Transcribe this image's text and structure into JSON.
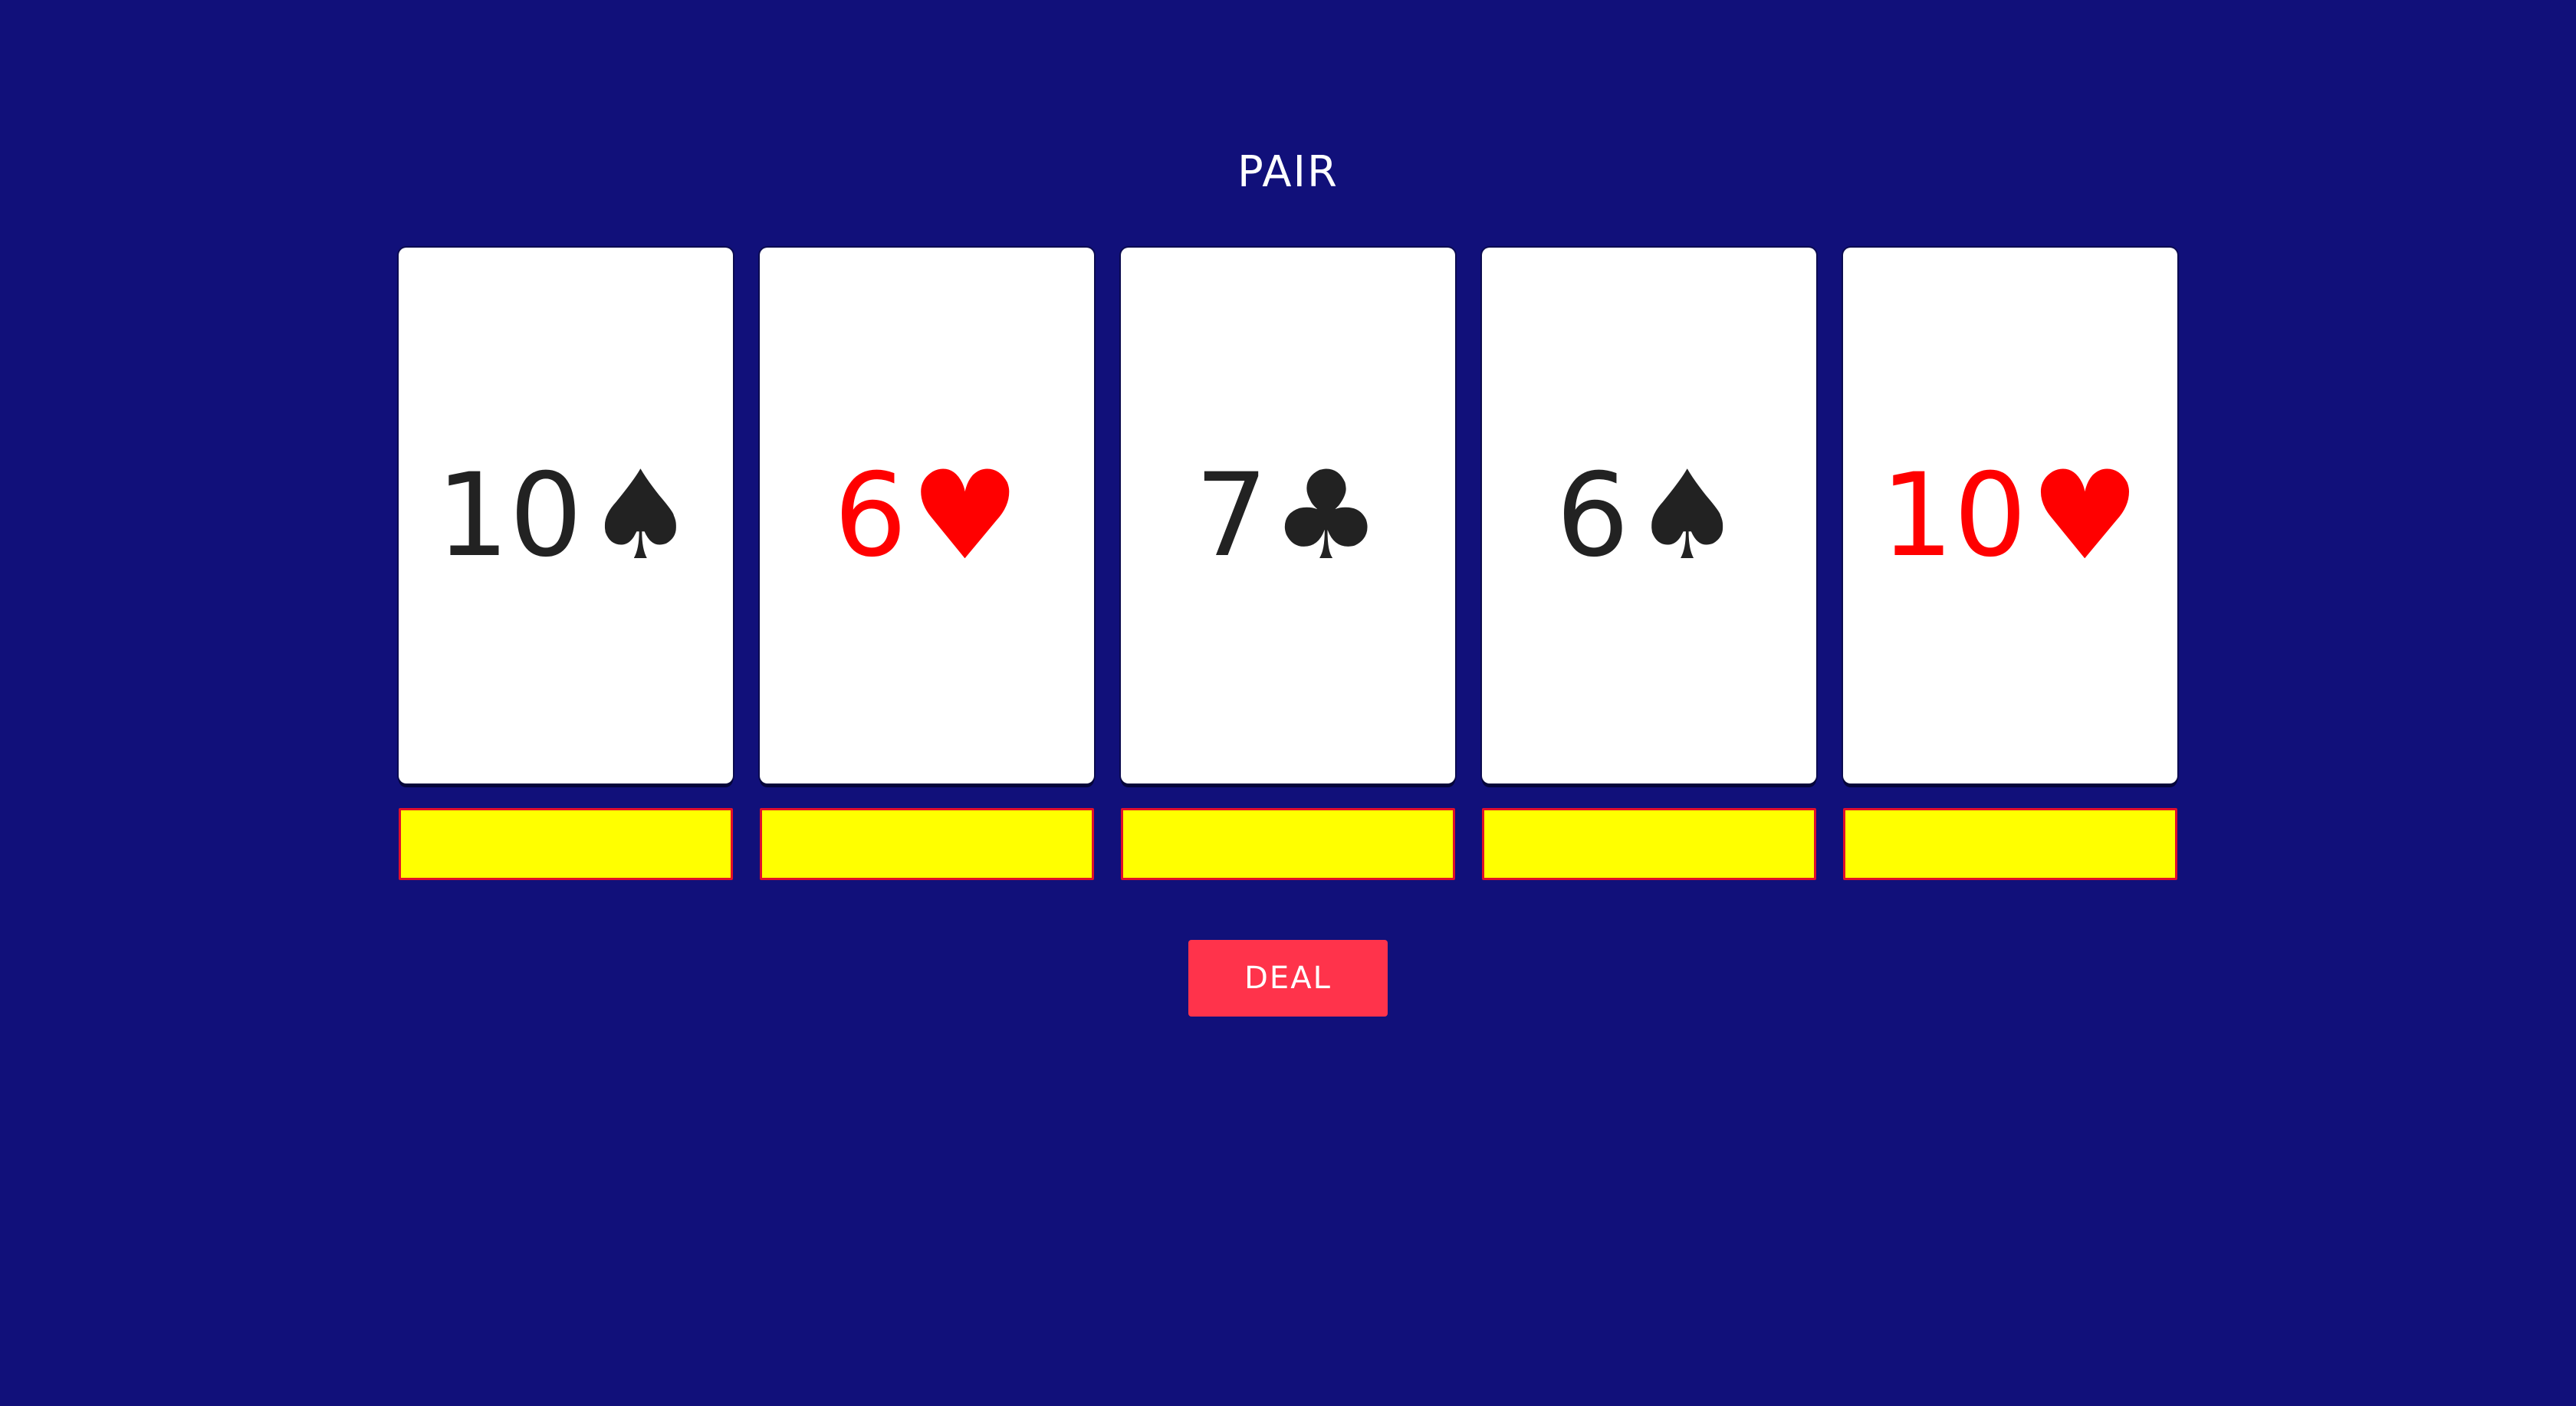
{
  "result_text": "PAIR",
  "colors": {
    "background": "#11107a",
    "card": "#ffffff",
    "black_suit": "#222222",
    "red_suit": "#ff0000",
    "hold_fill": "#ffff00",
    "hold_border": "#e0102a",
    "deal_button": "#ff334b"
  },
  "cards": [
    {
      "rank": "10",
      "suit": "♠",
      "suit_name": "spade-icon",
      "color": "#222222"
    },
    {
      "rank": "6",
      "suit": "♥",
      "suit_name": "heart-icon",
      "color": "#ff0000"
    },
    {
      "rank": "7",
      "suit": "♣",
      "suit_name": "club-icon",
      "color": "#222222"
    },
    {
      "rank": "6",
      "suit": "♠",
      "suit_name": "spade-icon",
      "color": "#222222"
    },
    {
      "rank": "10",
      "suit": "♥",
      "suit_name": "heart-icon",
      "color": "#ff0000"
    }
  ],
  "deal_label": "DEAL"
}
